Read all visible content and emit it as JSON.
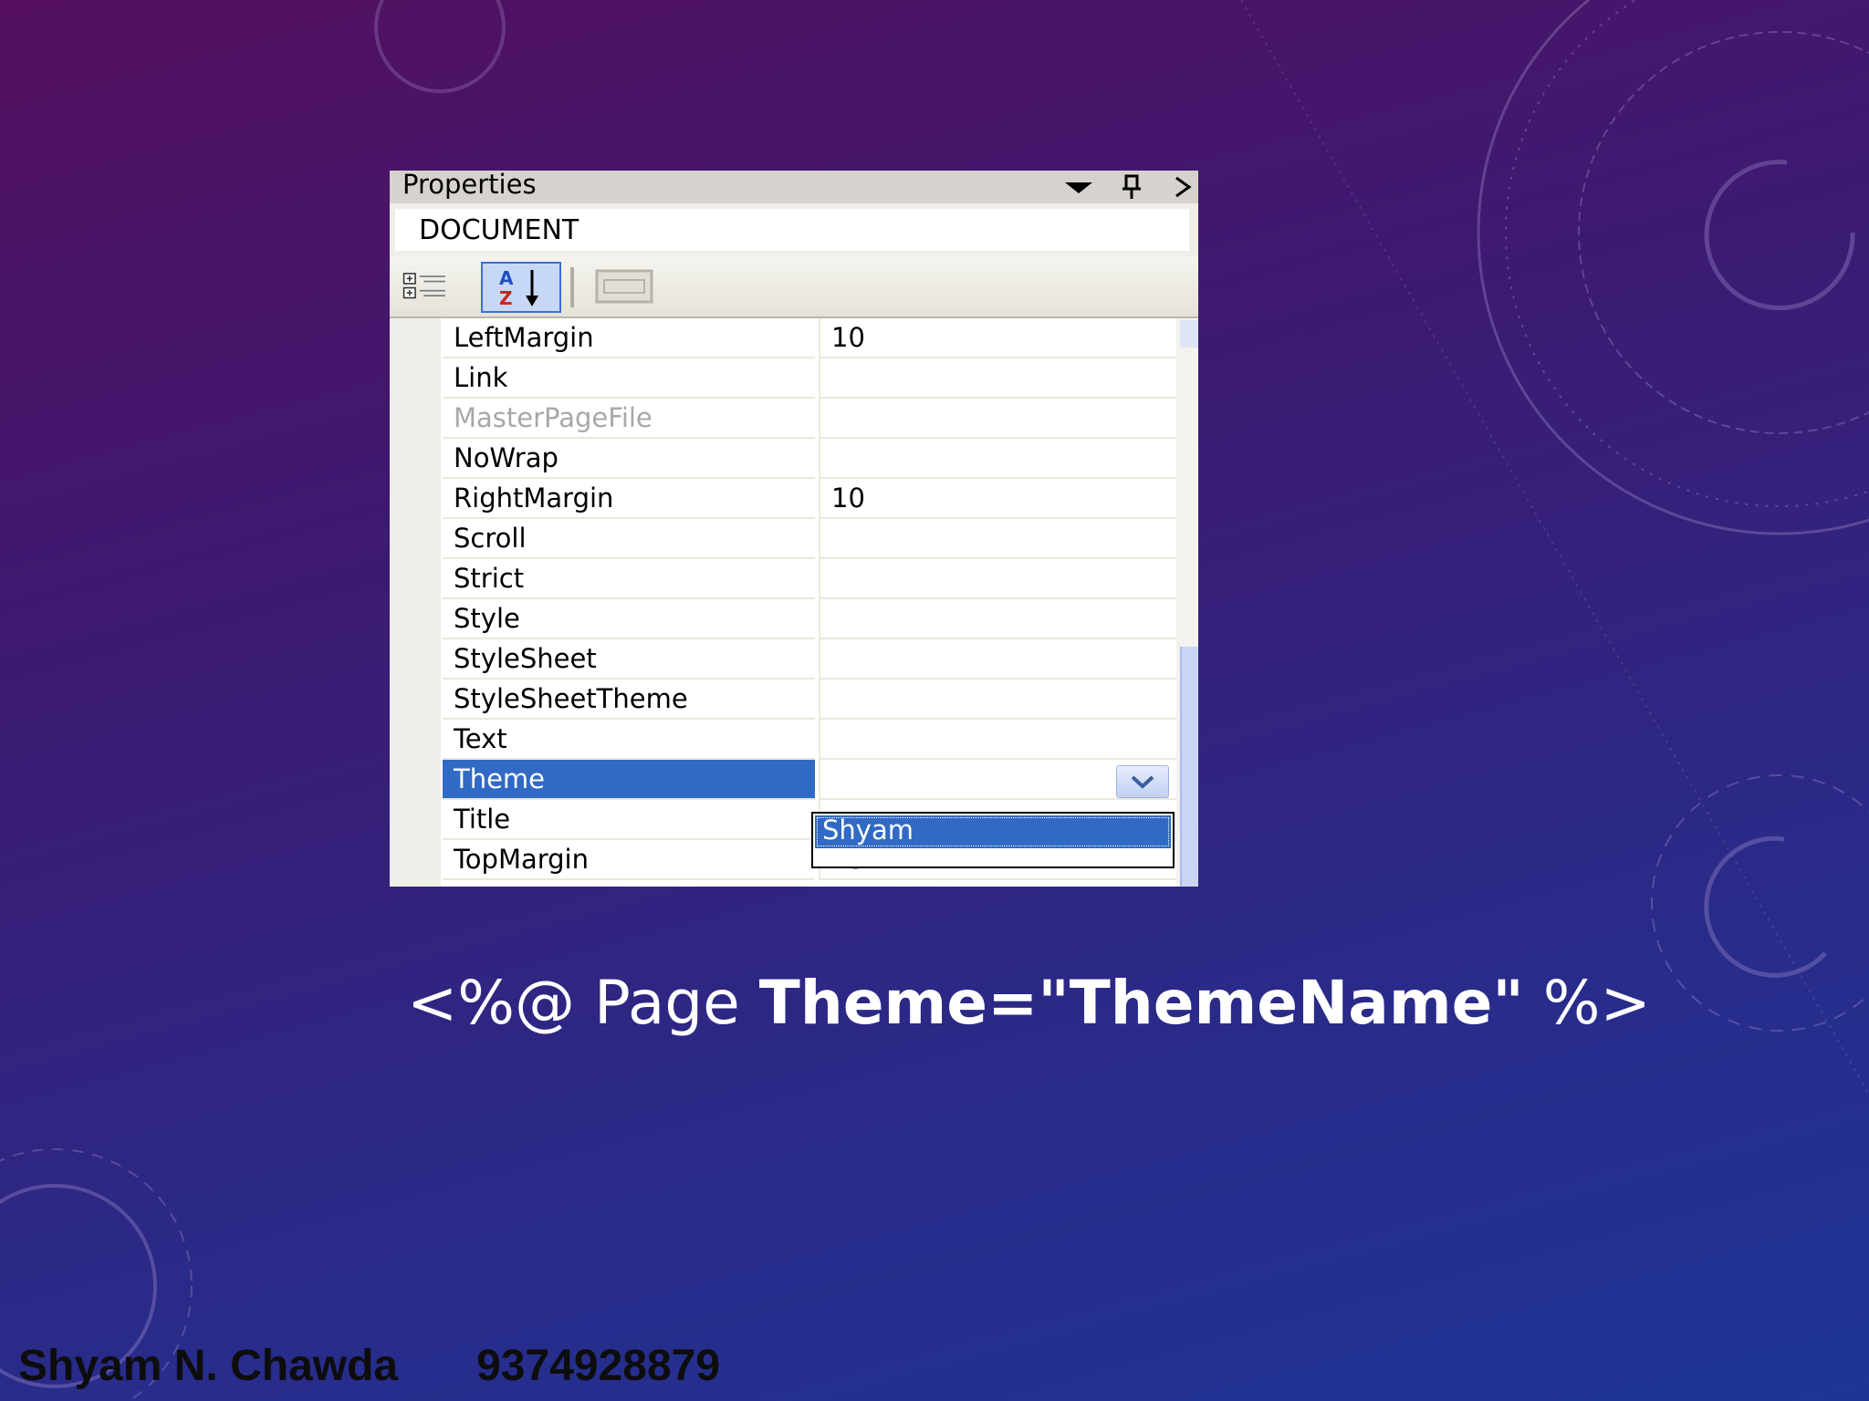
{
  "window": {
    "title": "Properties",
    "object_name": "DOCUMENT",
    "toolbar": {
      "categorized_icon": "categorized-icon",
      "alphabetical_icon": "alphabetical-sort-icon",
      "property_pages_icon": "property-pages-icon"
    }
  },
  "properties": [
    {
      "name": "LeftMargin",
      "value": "10"
    },
    {
      "name": "Link",
      "value": ""
    },
    {
      "name": "MasterPageFile",
      "value": ""
    },
    {
      "name": "NoWrap",
      "value": ""
    },
    {
      "name": "RightMargin",
      "value": "10"
    },
    {
      "name": "Scroll",
      "value": ""
    },
    {
      "name": "Strict",
      "value": ""
    },
    {
      "name": "Style",
      "value": ""
    },
    {
      "name": "StyleSheet",
      "value": ""
    },
    {
      "name": "StyleSheetTheme",
      "value": ""
    },
    {
      "name": "Text",
      "value": ""
    },
    {
      "name": "Theme",
      "value": ""
    },
    {
      "name": "Title",
      "value": ""
    },
    {
      "name": "TopMargin",
      "value": "15"
    }
  ],
  "theme_dropdown": {
    "options": [
      "Shyam"
    ]
  },
  "code": {
    "prefix": "<%@ Page ",
    "bold": "Theme=\"ThemeName\"",
    "suffix": " %>"
  },
  "footer": {
    "author": "Shyam N. Chawda",
    "phone": "9374928879"
  },
  "colors": {
    "selection": "#316ac5",
    "panel": "#d6d3ce"
  }
}
